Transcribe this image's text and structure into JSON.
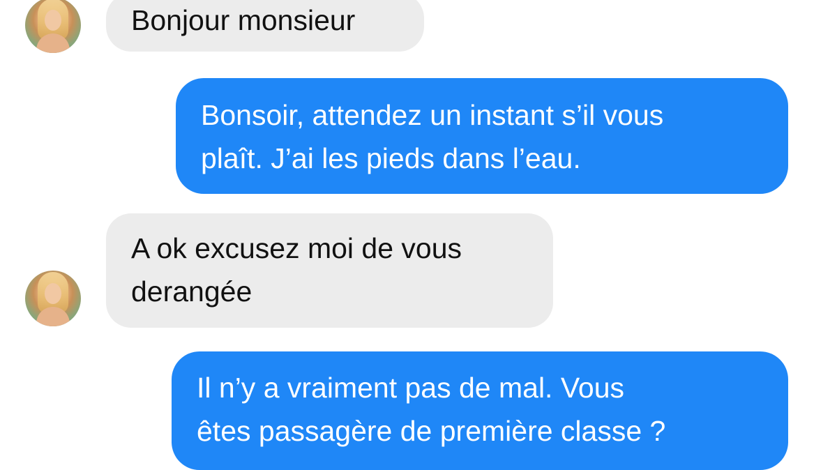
{
  "conversation": {
    "messages": [
      {
        "sender": "contact",
        "lines": [
          "Bonjour monsieur"
        ]
      },
      {
        "sender": "me",
        "lines": [
          "Bonsoir, attendez un instant s’il vous",
          "plaît. J’ai les pieds dans l’eau."
        ]
      },
      {
        "sender": "contact",
        "lines": [
          "A ok excusez moi de vous",
          "derangée"
        ]
      },
      {
        "sender": "me",
        "lines": [
          "Il n’y a vraiment pas de mal. Vous",
          "êtes passagère de première classe ?"
        ]
      }
    ]
  },
  "colors": {
    "sent_bubble": "#1f87f7",
    "received_bubble": "#ececec",
    "sent_text": "#ffffff",
    "received_text": "#111111"
  },
  "icons": {
    "contact_avatar": "contact-avatar"
  }
}
